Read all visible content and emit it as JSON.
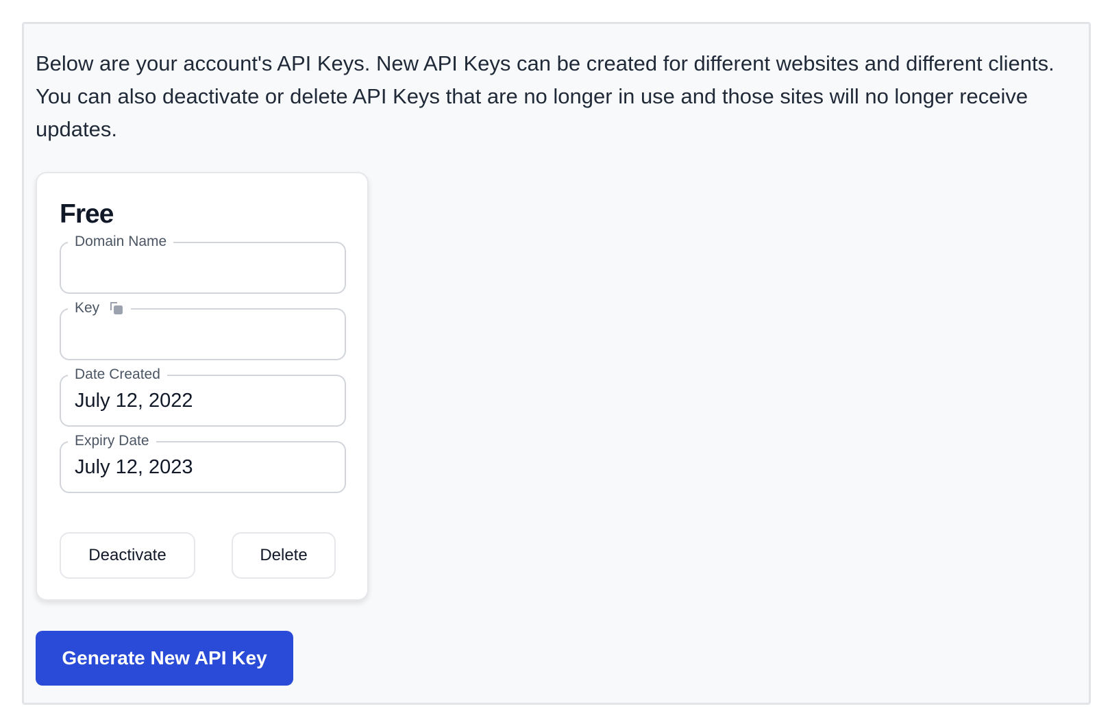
{
  "intro_text": "Below are your account's API Keys. New API Keys can be created for different websites and different clients. You can also deactivate or delete API Keys that are no longer in use and those sites will no longer receive updates.",
  "api_key_card": {
    "plan_title": "Free",
    "fields": {
      "domain_name": {
        "label": "Domain Name",
        "value": ""
      },
      "key": {
        "label": "Key",
        "value": "",
        "icon": "copy-icon"
      },
      "date_created": {
        "label": "Date Created",
        "value": "July 12, 2022"
      },
      "expiry_date": {
        "label": "Expiry Date",
        "value": "July 12, 2023"
      }
    },
    "buttons": {
      "deactivate": "Deactivate",
      "delete": "Delete"
    }
  },
  "generate_button": "Generate New API Key",
  "colors": {
    "primary": "#2a4bd7",
    "panel_background": "#f8f9fb",
    "field_border": "#d1d5db"
  }
}
